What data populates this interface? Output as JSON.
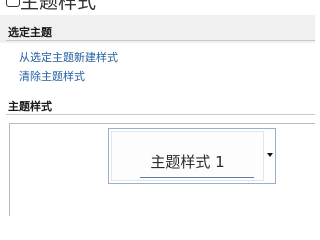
{
  "window": {
    "title": "主题样式"
  },
  "select_section": {
    "heading": "选定主题",
    "links": [
      "从选定主题新建样式",
      "清除主题样式"
    ]
  },
  "styles_section": {
    "heading": "主题样式",
    "items": [
      {
        "label": "主题样式 1",
        "selected": true
      }
    ]
  },
  "colors": {
    "link": "#1f5fa0",
    "header_background": "#f0f0f0",
    "tile_border": "#9bb0c6",
    "tile_underline": "#5a7ea6"
  }
}
